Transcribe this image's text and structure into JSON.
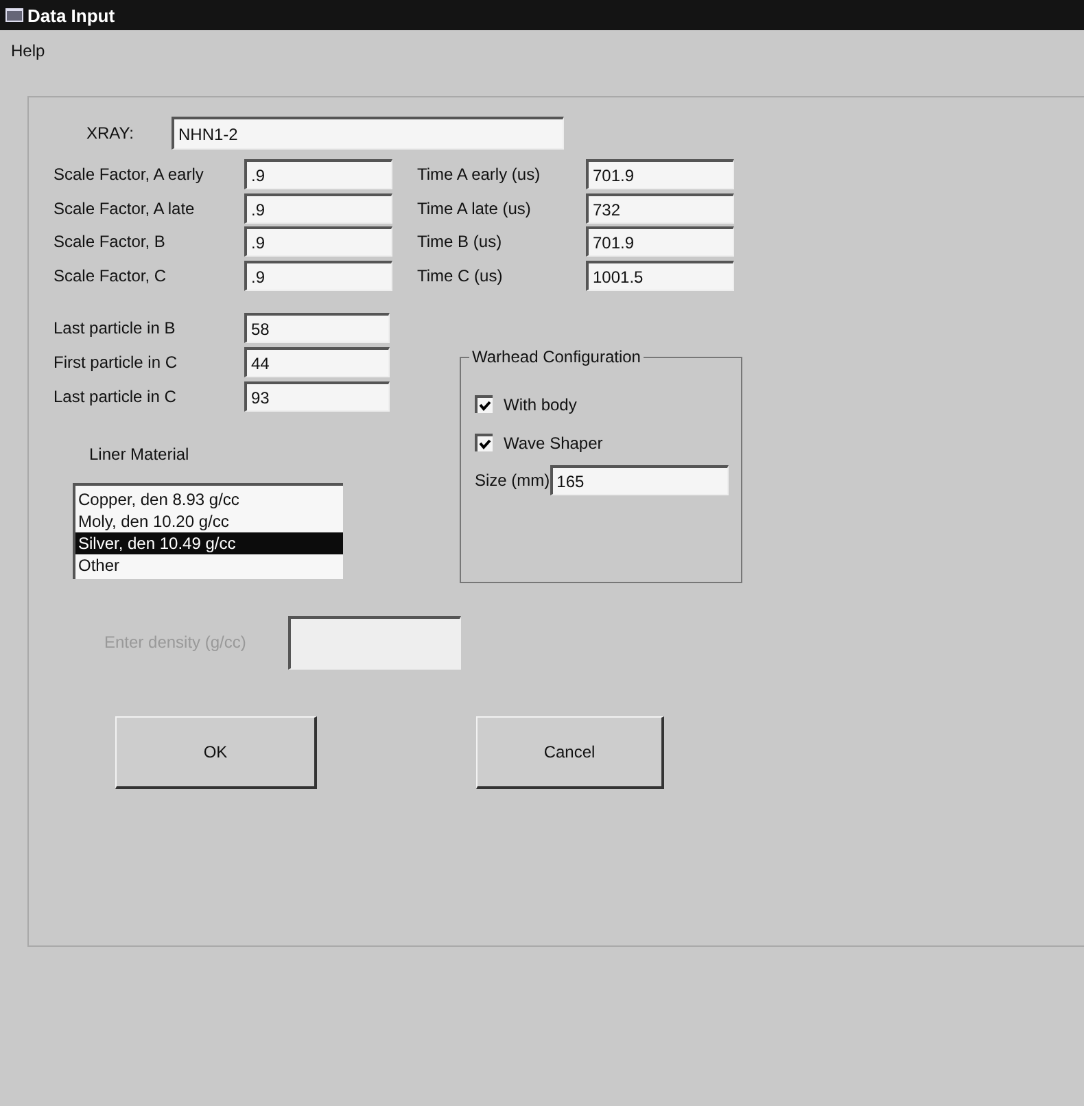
{
  "window": {
    "title": "Data Input"
  },
  "menu": [
    "Help"
  ],
  "xray": {
    "label": "XRAY:",
    "value": "NHN1-2"
  },
  "scale_factors": [
    {
      "label": "Scale Factor, A early",
      "value": ".9"
    },
    {
      "label": "Scale Factor, A late",
      "value": ".9"
    },
    {
      "label": "Scale Factor, B",
      "value": ".9"
    },
    {
      "label": "Scale Factor, C",
      "value": ".9"
    }
  ],
  "times": [
    {
      "label": "Time A early (us)",
      "value": "701.9"
    },
    {
      "label": "Time A late (us)",
      "value": "732"
    },
    {
      "label": "Time B (us)",
      "value": "701.9"
    },
    {
      "label": "Time C (us)",
      "value": "1001.5"
    }
  ],
  "particles": [
    {
      "label": "Last particle in B",
      "value": "58"
    },
    {
      "label": "First particle in C",
      "value": "44"
    },
    {
      "label": "Last particle in C",
      "value": "93"
    }
  ],
  "liner_material": {
    "label": "Liner Material",
    "items": [
      {
        "label": "Copper, den 8.93 g/cc",
        "selected": false
      },
      {
        "label": "Moly, den 10.20 g/cc",
        "selected": false
      },
      {
        "label": "Silver, den 10.49 g/cc",
        "selected": true
      },
      {
        "label": "Other",
        "selected": false
      }
    ]
  },
  "warhead_configuration": {
    "title": "Warhead Configuration",
    "checkboxes": [
      {
        "label": "With body",
        "checked": true
      },
      {
        "label": "Wave Shaper",
        "checked": true
      }
    ],
    "size": {
      "label": "Size (mm)",
      "value": "165"
    }
  },
  "density": {
    "label": "Enter density (g/cc)",
    "disabled": true
  },
  "buttons": [
    "OK",
    "Cancel"
  ]
}
